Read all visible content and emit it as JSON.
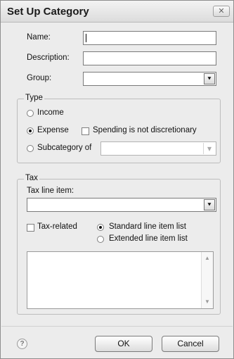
{
  "dialog": {
    "title": "Set Up Category",
    "close_icon": "close-icon"
  },
  "fields": {
    "name_label": "Name:",
    "name_value": "",
    "description_label": "Description:",
    "description_value": "",
    "group_label": "Group:",
    "group_value": "",
    "group_dropdown_glyph": "⯆"
  },
  "type": {
    "legend": "Type",
    "income_label": "Income",
    "expense_label": "Expense",
    "selected": "Expense",
    "spending_checkbox_label": "Spending is not discretionary",
    "spending_checked": false,
    "subcategory_label": "Subcategory of",
    "subcategory_value": "",
    "subcategory_dropdown_glyph": "▾"
  },
  "tax": {
    "legend": "Tax",
    "tax_line_label": "Tax line item:",
    "tax_line_value": "",
    "tax_line_dropdown_glyph": "⯆",
    "tax_related_label": "Tax-related",
    "tax_related_checked": false,
    "standard_list_label": "Standard line item list",
    "extended_list_label": "Extended line item list",
    "list_selected": "Standard line item list"
  },
  "footer": {
    "help_glyph": "?",
    "ok_label": "OK",
    "cancel_label": "Cancel"
  }
}
